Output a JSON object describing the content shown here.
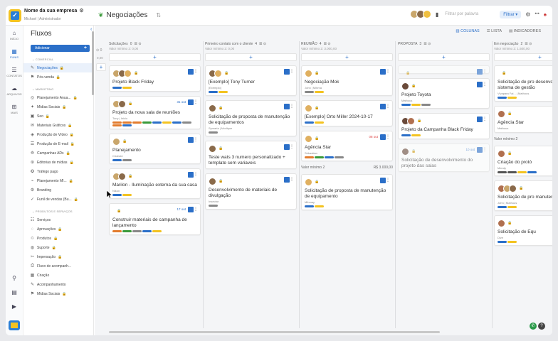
{
  "company": {
    "name": "Nome da sua empresa",
    "user": "Michael | Administrador"
  },
  "pipeline": {
    "title": "Negociações"
  },
  "search": {
    "placeholder": "Filtrar por palavra"
  },
  "filter_label": "Filtrar",
  "views": [
    {
      "label": "COLUNAS",
      "active": true
    },
    {
      "label": "LISTA",
      "active": false
    },
    {
      "label": "INDICADORES",
      "active": false
    }
  ],
  "rail": [
    {
      "icon": "home-icon",
      "label": "INÍCIO",
      "g": "⌂"
    },
    {
      "icon": "funnel-icon",
      "label": "FUNIS",
      "g": "▦",
      "active": true
    },
    {
      "icon": "contacts-icon",
      "label": "CONTATOS",
      "g": "☰"
    },
    {
      "icon": "cloud-icon",
      "label": "ARQUIVOS",
      "g": "☁"
    },
    {
      "icon": "apps-icon",
      "label": "MAIS",
      "g": "⊞"
    }
  ],
  "rail_bottom": [
    {
      "icon": "search-icon",
      "g": "⚲"
    },
    {
      "icon": "chart-icon",
      "g": "▤"
    },
    {
      "icon": "play-icon",
      "g": "▶"
    }
  ],
  "sidebar": {
    "title": "Fluxos",
    "add_label": "Adicionar",
    "sections": [
      {
        "label": "COMERCIAL",
        "items": [
          {
            "label": "Negociações",
            "active": true,
            "locked": true
          },
          {
            "label": "Pós-venda",
            "locked": true
          }
        ]
      },
      {
        "label": "MARKETING",
        "items": [
          {
            "label": "Planejamento Anua...",
            "locked": true
          },
          {
            "label": "Mídias Sociais",
            "locked": true
          },
          {
            "label": "Seo",
            "locked": true
          },
          {
            "label": "Materiais Gráficos",
            "locked": true
          },
          {
            "label": "Produção de Vídeo",
            "locked": true
          },
          {
            "label": "Produção de E-mail",
            "locked": true
          },
          {
            "label": "Campanhas ADs",
            "locked": true
          },
          {
            "label": "Editorias de mídias",
            "locked": true
          },
          {
            "label": "Tráfego pago",
            "locked": false
          },
          {
            "label": "Planejamento MI...",
            "locked": true
          },
          {
            "label": "Branding",
            "locked": false
          },
          {
            "label": "Funil de vendas (Bu...",
            "locked": true
          }
        ]
      },
      {
        "label": "PRODUTOS E SERVIÇOS",
        "items": [
          {
            "label": "Serviços"
          },
          {
            "label": "Aprovações",
            "locked": true
          },
          {
            "label": "Produtos",
            "locked": true
          },
          {
            "label": "Suporte",
            "locked": true
          },
          {
            "label": "Impersação",
            "locked": true
          },
          {
            "label": "Fluxo de acompanh...",
            "locked": false
          },
          {
            "label": "Criação"
          },
          {
            "label": "Acompanhamento"
          },
          {
            "label": "Mídias Sociais",
            "locked": true
          }
        ]
      }
    ]
  },
  "colors": {
    "accent": "#2b6fc8"
  },
  "columns": [
    {
      "title": "Solicitações",
      "count": "0",
      "total": "Valor mínimo 2: 0,00",
      "cards": [
        {
          "title": "Projeto Black Friday",
          "avatars": 3,
          "tags": [
            "#2b6fc8",
            "#f3c322"
          ]
        },
        {
          "title": "Projeto da nova sala de reuniões",
          "sub": "Tony | Inicio",
          "date": "31 out",
          "avatars": 2,
          "tags": [
            "#e27c2e",
            "#e27c2e",
            "#e27c2e",
            "#3a9a3a",
            "#2b6fc8",
            "#f3c322",
            "#2b6fc8",
            "#888",
            "#e27c2e",
            "#2b6fc8"
          ]
        },
        {
          "title": "Planejamento",
          "sub": "Cisteate",
          "avatars": 1,
          "tags": [
            "#2b6fc8",
            "#888"
          ]
        },
        {
          "title": "Marilon - Iluminação externa da sua casa",
          "sub": "Nikon",
          "avatars": 2,
          "tags": [
            "#2b6fc8",
            "#f3c322"
          ]
        },
        {
          "title": "Construir materiais de campanha de lançamento",
          "date": "17 out",
          "avatars": 0,
          "tags": [
            "#e27c2e",
            "#3a9a3a",
            "#888",
            "#2b6fc8",
            "#f3c322"
          ]
        }
      ]
    },
    {
      "title": "Primeiro contato com o cliente",
      "count": "4",
      "total": "Valor mínimo 2: 0,00",
      "cards": [
        {
          "title": "[Exemplo] Tony Turner",
          "sub": "[Exemplo]",
          "avatars": 2,
          "tags": [
            "#2b6fc8",
            "#f3c322"
          ]
        },
        {
          "title": "Solicitação de proposta de manutenção de equipamentos",
          "sub": "Symaria | Modique",
          "avatars": 1,
          "tags": [
            "#888"
          ]
        },
        {
          "title": "Teste wats 3 numero personalizado + template sem variaveis",
          "avatars": 1,
          "tags": []
        },
        {
          "title": "Desenvolvimento de materiais de divulgação",
          "sub": "Insectar",
          "avatars": 1,
          "tags": [
            "#888"
          ]
        }
      ]
    },
    {
      "title": "REUNIÃO",
      "count": "4",
      "total": "Valor mínimo 2: 3.000,00",
      "cards": [
        {
          "title": "Negociação Mok",
          "sub": "John | Mihma",
          "avatars": 1,
          "tags": [
            "#888",
            "#f3c322"
          ]
        },
        {
          "title": "[Exemplo] Orto Miller 2024-10-17",
          "avatars": 1,
          "tags": [
            "#2b6fc8",
            "#f3c322"
          ]
        },
        {
          "title": "Agência Star",
          "sub": "Sébastian",
          "date": "08 out",
          "dateRed": true,
          "avatars": 1,
          "tags": [
            "#e27c2e",
            "#3a9a3a",
            "#2b6fc8",
            "#888"
          ]
        },
        {
          "foot": [
            "Valor mínimo 2",
            "R$ 3.000,00"
          ]
        },
        {
          "title": "Solicitação de proposta de manutenção de equipamento",
          "sub": "Mihmay",
          "avatars": 1,
          "tags": [
            "#2b6fc8",
            "#f3c322"
          ]
        }
      ]
    },
    {
      "title": "PROPOSTA",
      "count": "3",
      "total": "",
      "cards": [
        {
          "grey": true,
          "avatars": 0,
          "tags": []
        },
        {
          "title": "Projeto Toyota",
          "sub": "Mathous",
          "avatars": 1,
          "tags": [
            "#2b6fc8",
            "#f3c322",
            "#888"
          ]
        },
        {
          "title": "Projeto da Campanha Black Friday",
          "avatars": 2,
          "tags": [
            "#2b6fc8",
            "#f3c322"
          ]
        },
        {
          "grey": true,
          "title": "Solicitação de desenvolvimento do projeto das salas",
          "date": "10 out",
          "avatars": 1,
          "tags": []
        }
      ]
    },
    {
      "title": "Em negociação",
      "count": "2",
      "total": "Valor mínimo 2: 1.500,00",
      "cards": [
        {
          "title": "Solicitação de pro desenvolvimento m sistema de gestão",
          "sub": "Vivapara Fal... | Mathous",
          "avatars": 0,
          "tags": [
            "#2b6fc8",
            "#f3c322"
          ]
        },
        {
          "title": "Agência Star",
          "sub": "Mathous",
          "avatars": 1,
          "tags": []
        },
        {
          "foot": [
            "Valor mínimo 2",
            ""
          ]
        },
        {
          "title": "Criação do protó",
          "sub": "Mendy",
          "avatars": 1,
          "tags": [
            "#555",
            "#555",
            "#f3c322",
            "#2b6fc8"
          ]
        },
        {
          "title": "Solicitação de pro manutenção",
          "sub": "John | Mathous",
          "avatars": 3,
          "tags": [
            "#2b6fc8",
            "#f3c322"
          ]
        },
        {
          "title": "Solicitação de Equ",
          "sub": "Dive",
          "avatars": 1,
          "tags": [
            "#2b6fc8",
            "#f3c322"
          ]
        }
      ]
    }
  ]
}
